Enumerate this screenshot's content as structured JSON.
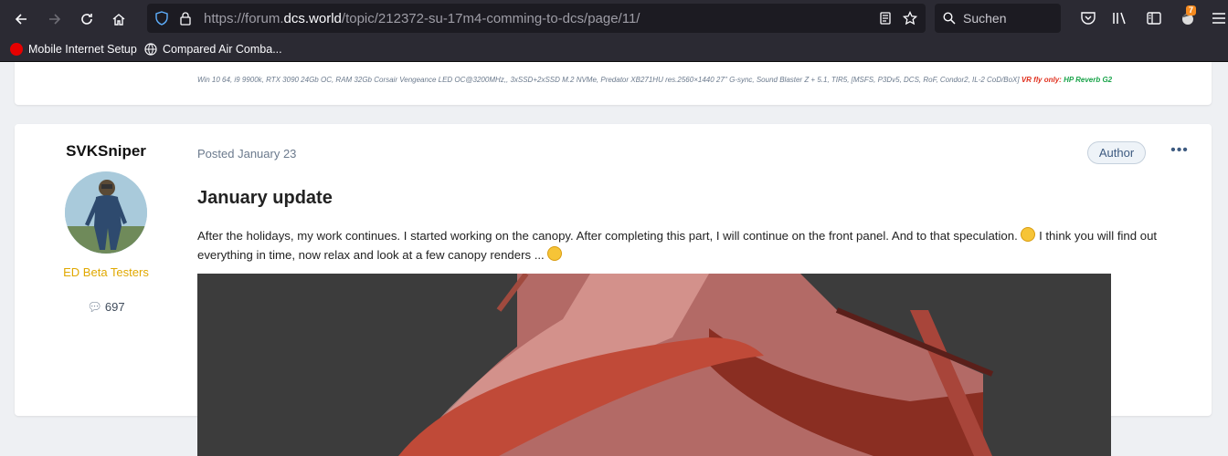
{
  "browser": {
    "url_prefix": "https://forum.",
    "url_domain": "dcs.world",
    "url_path": "/topic/212372-su-17m4-comming-to-dcs/page/11/",
    "search_placeholder": "Suchen",
    "notification_count": "7",
    "bookmarks": [
      {
        "label": "Mobile Internet Setup",
        "icon": "vodafone-icon",
        "color": "#e60000"
      },
      {
        "label": "Compared Air Comba...",
        "icon": "globe-icon",
        "color": "#fbfbfe"
      }
    ]
  },
  "previous_post": {
    "signature_text": "Win 10 64, i9 9900k, RTX  3090 24Gb OC, RAM 32Gb Corsair Vengeance LED OC@3200MHz,, 3xSSD+2xSSD M.2 NVMe, Predator XB271HU res.2560×1440 27'' G-sync, Sound Blaster Z + 5.1, TIR5, [MSFS, P3Dv5, DCS, RoF, Condor2, IL-2 CoD/BoX] ",
    "signature_vr_label": "VR fly only:",
    "signature_vr_device": " HP Reverb G2"
  },
  "post": {
    "author": "SVKSniper",
    "group": "ED Beta Testers",
    "post_count": "697",
    "posted": "Posted January 23",
    "badge": "Author",
    "more": "•••",
    "title": "January update",
    "body_part1": "After the holidays, my work continues. I started working on the canopy. After completing this part, I will continue on the front panel. And to that speculation. ",
    "body_part2": " I think you will find out everything in time, now relax and look at a few canopy renders ... "
  },
  "colors": {
    "chrome_bg": "#2b2a33",
    "group_color": "#e0a800",
    "accent": "#3d5a80"
  }
}
